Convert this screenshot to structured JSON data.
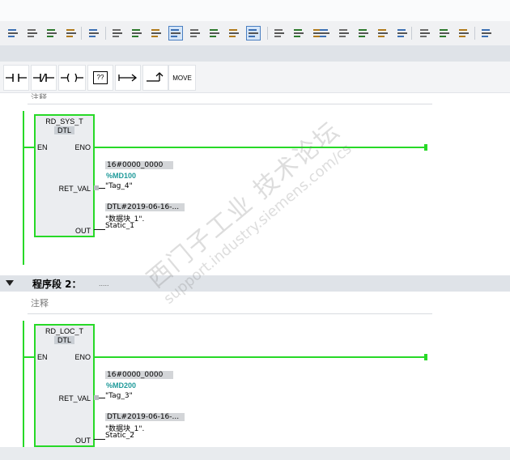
{
  "toolbar": {
    "buttons": [
      "insert-network-icon",
      "delete-network-icon",
      "insert-row-icon",
      "append-row-icon",
      "absolute-symbolic-icon",
      "network-overview-icon",
      "favorites-icon",
      "program-status-icon",
      "comment-display-icon",
      "open-all-networks-icon",
      "close-all-networks-icon",
      "show-tags-icon",
      "operand-display-icon",
      "navigate-icon",
      "go-to-error-icon",
      "go-to-next-icon",
      "go-to-previous-icon",
      "update-calls-icon",
      "monitor-on-off-icon",
      "modify-value-icon",
      "monitor-structure-icon",
      "expand-icon",
      "collapse-icon",
      "refresh-icon",
      "monitor-all-icon"
    ]
  },
  "palette": {
    "items": [
      {
        "icon": "no-contact-icon"
      },
      {
        "icon": "nc-contact-icon"
      },
      {
        "icon": "coil-icon"
      },
      {
        "icon": "empty-box-icon",
        "label": "??"
      },
      {
        "icon": "open-branch-icon"
      },
      {
        "icon": "close-branch-icon"
      },
      {
        "label": "MOVE"
      }
    ]
  },
  "network1": {
    "comment_partial": "注释",
    "block": {
      "name": "RD_SYS_T",
      "type": "DTL"
    },
    "pins": {
      "en": "EN",
      "eno": "ENO",
      "ret_val": "RET_VAL",
      "out": "OUT"
    },
    "ret_val": {
      "value": "16#0000_0000",
      "address": "%MD100",
      "tag": "\"Tag_4\""
    },
    "out": {
      "value": "DTL#2019-06-16-...",
      "tag_line1": "\"数据块_1\".",
      "tag_line2": "Static_1"
    }
  },
  "network2": {
    "header_title": "程序段 2：",
    "header_dots": ".....",
    "comment": "注释",
    "block": {
      "name": "RD_LOC_T",
      "type": "DTL"
    },
    "pins": {
      "en": "EN",
      "eno": "ENO",
      "ret_val": "RET_VAL",
      "out": "OUT"
    },
    "ret_val": {
      "value": "16#0000_0000",
      "address": "%MD200",
      "tag": "\"Tag_3\""
    },
    "out": {
      "value": "DTL#2019-06-16-...",
      "tag_line1": "\"数据块_1\".",
      "tag_line2": "Static_2"
    }
  },
  "watermark": {
    "line1": "西门子工业 技术论坛",
    "line2": "support.industry.siemens.com/cs"
  }
}
